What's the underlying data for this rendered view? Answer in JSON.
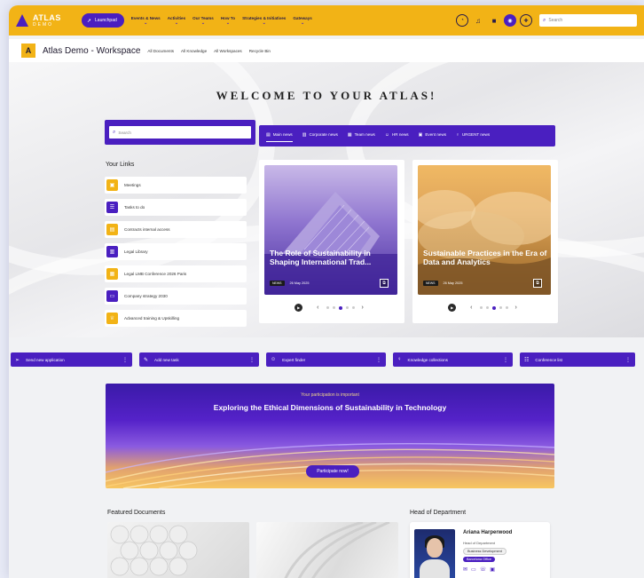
{
  "topnav": {
    "logo": {
      "line1": "ATLAS",
      "line2": "DEMO"
    },
    "launchpad": "Launchpad",
    "items": [
      "Events & News",
      "Activities",
      "Our Teams",
      "How To",
      "Strategies & Initiatives",
      "Gateways"
    ],
    "search_placeholder": "Search"
  },
  "workspace": {
    "badge": "A",
    "title": "Atlas Demo - Workspace",
    "links": [
      "All Documents",
      "All Knowledge",
      "All Workspaces",
      "Recycle Bin"
    ]
  },
  "hero": {
    "welcome": "WELCOME TO YOUR ATLAS!",
    "search_placeholder": "Search"
  },
  "your_links": {
    "title": "Your Links",
    "items": [
      {
        "label": "Meetings",
        "icon": "meeting-icon",
        "color": "#f2b316"
      },
      {
        "label": "Tasks to do",
        "icon": "tasks-icon",
        "color": "#4a1fc0"
      },
      {
        "label": "Contracts internal access",
        "icon": "document-icon",
        "color": "#f2b316"
      },
      {
        "label": "Legal Library",
        "icon": "library-icon",
        "color": "#4a1fc0"
      },
      {
        "label": "Legal LMB Conference 2026 Paris",
        "icon": "calendar-icon",
        "color": "#f2b316"
      },
      {
        "label": "Company strategy 2030",
        "icon": "briefcase-icon",
        "color": "#4a1fc0"
      },
      {
        "label": "Advanced training & Upskilling",
        "icon": "trophy-icon",
        "color": "#f2b316"
      }
    ]
  },
  "news": {
    "tabs": [
      "Main news",
      "Corporate news",
      "Team news",
      "HR news",
      "Event news",
      "URGENT news"
    ],
    "cards": [
      {
        "title": "The Role of Sustainability in Shaping International Trad...",
        "tag": "NEWS",
        "date": "26 May 2025"
      },
      {
        "title": "Sustainable Practices in the Era of Data and Analytics",
        "tag": "NEWS",
        "date": "26 May 2025"
      }
    ]
  },
  "quick_actions": [
    {
      "label": "Send new application",
      "icon": "send-icon"
    },
    {
      "label": "Add new task",
      "icon": "task-add-icon"
    },
    {
      "label": "Expert finder",
      "icon": "people-icon"
    },
    {
      "label": "Knowledge collections",
      "icon": "bulb-icon"
    },
    {
      "label": "Conference list",
      "icon": "list-icon"
    }
  ],
  "banner": {
    "subtitle": "Your participation is important",
    "title": "Exploring the Ethical Dimensions of Sustainability in Technology",
    "cta": "Participate now!"
  },
  "featured": {
    "title": "Featured Documents"
  },
  "head_of_department": {
    "title": "Head of Department",
    "name": "Ariana Harperwood",
    "role": "Head of Department",
    "department": "Business Development",
    "office": "Barcelona Office"
  },
  "colors": {
    "accent": "#4a1fc0",
    "brand_yellow": "#f2b316"
  }
}
